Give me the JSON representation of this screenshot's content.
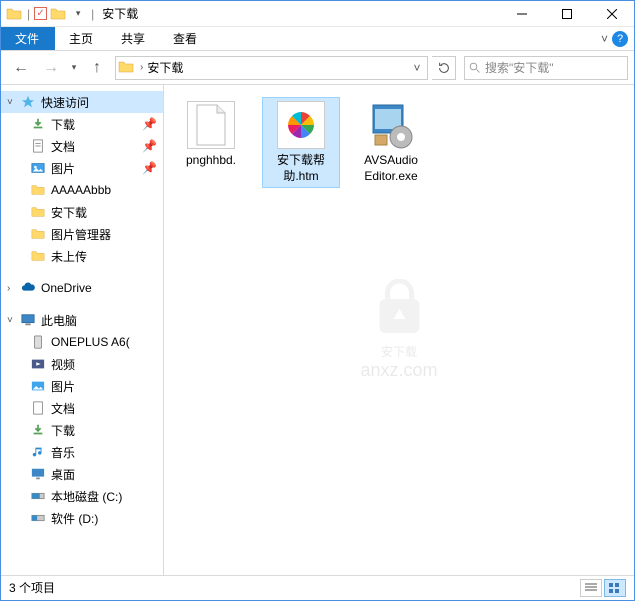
{
  "window": {
    "title": "安下载"
  },
  "ribbon": {
    "file": "文件",
    "home": "主页",
    "share": "共享",
    "view": "查看"
  },
  "nav": {
    "address_segment": "安下载",
    "search_placeholder": "搜索\"安下载\""
  },
  "sidebar": {
    "quick_access": "快速访问",
    "downloads": "下载",
    "documents": "文档",
    "pictures": "图片",
    "folder_a": "AAAAAbbb",
    "folder_anxz": "安下载",
    "folder_picmgr": "图片管理器",
    "folder_noupload": "未上传",
    "onedrive": "OneDrive",
    "this_pc": "此电脑",
    "oneplus": "ONEPLUS A6(",
    "videos": "视频",
    "pictures2": "图片",
    "documents2": "文档",
    "downloads2": "下载",
    "music": "音乐",
    "desktop": "桌面",
    "disk_c": "本地磁盘 (C:)",
    "disk_d": "软件 (D:)"
  },
  "files": {
    "f1": "pnghhbd.",
    "f2_l1": "安下载帮",
    "f2_l2": "助.htm",
    "f3_l1": "AVSAudio",
    "f3_l2": "Editor.exe"
  },
  "status": {
    "items": "3 个项目"
  },
  "watermark": {
    "l1": "安下载",
    "l2": "anxz.com"
  }
}
